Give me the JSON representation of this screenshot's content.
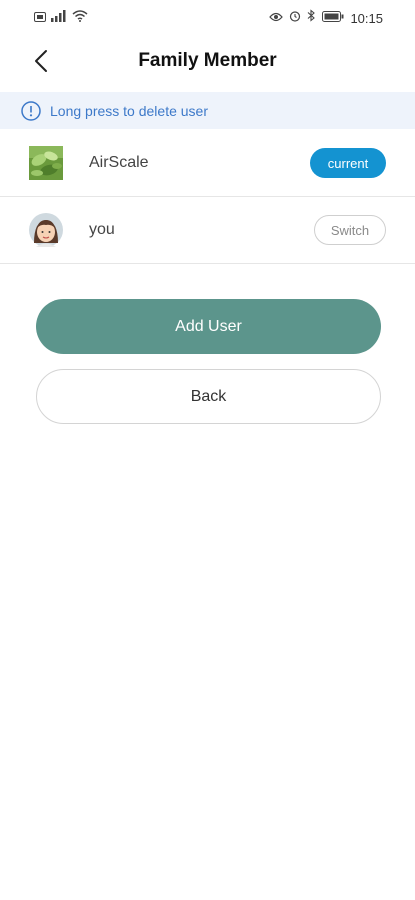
{
  "status_bar": {
    "time": "10:15",
    "icons": [
      "sim-icon",
      "signal-icon",
      "wifi-icon",
      "eye-icon",
      "alarm-icon",
      "bluetooth-icon",
      "battery-icon"
    ]
  },
  "header": {
    "title": "Family Member",
    "back_icon": "chevron-left-icon"
  },
  "banner": {
    "text": "Long press to delete user",
    "icon": "info-icon",
    "color": "#3d79c9",
    "background": "#eef3fb"
  },
  "users": [
    {
      "name": "AirScale",
      "avatar": "leaf-photo",
      "status_label": "current"
    },
    {
      "name": "you",
      "avatar": "girl-avatar",
      "action_label": "Switch"
    }
  ],
  "buttons": {
    "add_user": "Add User",
    "back": "Back"
  },
  "colors": {
    "accent_green": "#5c958c",
    "current_blue": "#1493d1"
  }
}
